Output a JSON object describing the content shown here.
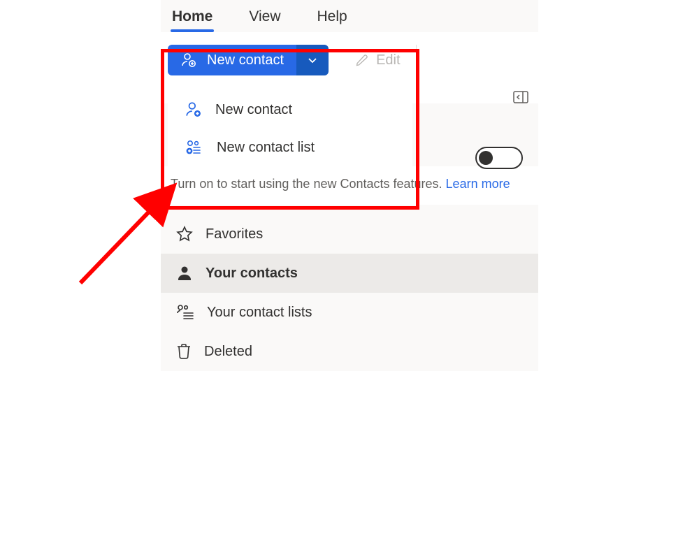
{
  "tabs": {
    "home": "Home",
    "view": "View",
    "help": "Help"
  },
  "toolbar": {
    "new_contact": "New contact",
    "edit": "Edit"
  },
  "dropdown": {
    "new_contact": "New contact",
    "new_contact_list": "New contact list"
  },
  "notice": {
    "text": "Turn on to start using the new Contacts features.  ",
    "learn_more": "Learn more"
  },
  "sidebar": {
    "favorites": "Favorites",
    "your_contacts": "Your contacts",
    "your_contact_lists": "Your contact lists",
    "deleted": "Deleted"
  }
}
